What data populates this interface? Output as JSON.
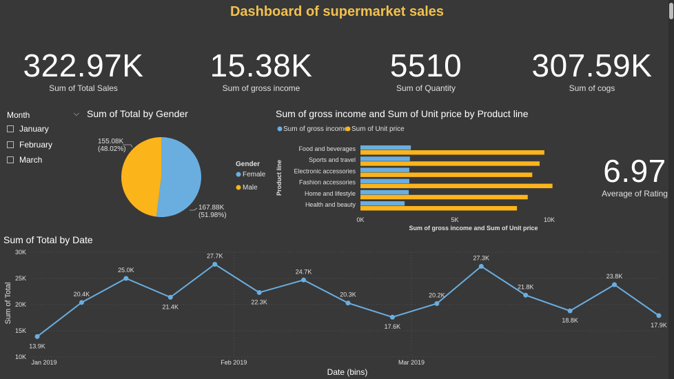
{
  "dashboard_title": "Dashboard of supermarket sales",
  "kpis": {
    "total_sales": {
      "value": "322.97K",
      "label": "Sum of Total Sales"
    },
    "gross_income": {
      "value": "15.38K",
      "label": "Sum of gross income"
    },
    "quantity": {
      "value": "5510",
      "label": "Sum of Quantity"
    },
    "cogs": {
      "value": "307.59K",
      "label": "Sum of cogs"
    },
    "rating": {
      "value": "6.97",
      "label": "Average of Rating"
    }
  },
  "slicer": {
    "title": "Month",
    "items": [
      "January",
      "February",
      "March"
    ]
  },
  "colors": {
    "background": "#383838",
    "title": "#f2c14e",
    "blue": "#6aaee0",
    "yellow": "#fbb41a"
  },
  "chart_data": [
    {
      "type": "pie",
      "title": "Sum of Total by Gender",
      "legend_title": "Gender",
      "slices": [
        {
          "name": "Female",
          "value": 167.88,
          "label": "167.88K",
          "pct": "(51.98%)"
        },
        {
          "name": "Male",
          "value": 155.08,
          "label": "155.08K",
          "pct": "(48.02%)"
        }
      ]
    },
    {
      "type": "bar",
      "orientation": "horizontal",
      "title": "Sum of gross income and Sum of Unit price by Product line",
      "categories": [
        "Food and beverages",
        "Sports and travel",
        "Electronic accessories",
        "Fashion accessories",
        "Home and lifestyle",
        "Health and beauty"
      ],
      "series": [
        {
          "name": "Sum of gross income",
          "values": [
            2670,
            2620,
            2590,
            2590,
            2560,
            2340
          ]
        },
        {
          "name": "Sum of Unit price",
          "values": [
            9740,
            9490,
            9100,
            10170,
            8860,
            8290
          ]
        }
      ],
      "xlabel": "Sum of gross income and Sum of Unit price",
      "ylabel": "Product line",
      "xlim": [
        0,
        10000
      ],
      "xticks": [
        "0K",
        "5K",
        "10K"
      ],
      "legend_position": "top-left"
    },
    {
      "type": "line",
      "title": "Sum of Total by Date",
      "xlabel": "Date (bins)",
      "ylabel": "Sum of Total",
      "x": [
        "2019-01-01",
        "2019-01-08",
        "2019-01-15",
        "2019-01-22",
        "2019-01-29",
        "2019-02-05",
        "2019-02-12",
        "2019-02-19",
        "2019-02-26",
        "2019-03-05",
        "2019-03-12",
        "2019-03-19",
        "2019-03-26",
        "2019-03-30"
      ],
      "values": [
        13.9,
        20.4,
        25.0,
        21.4,
        27.7,
        22.3,
        24.7,
        20.3,
        17.6,
        20.2,
        27.3,
        21.8,
        18.8,
        23.8,
        17.9
      ],
      "points": [
        {
          "date": "2019-01-01",
          "value": 13.9,
          "label": "13.9K"
        },
        {
          "date": "2019-01-08",
          "value": 20.4,
          "label": "20.4K"
        },
        {
          "date": "2019-01-15",
          "value": 25.0,
          "label": "25.0K"
        },
        {
          "date": "2019-01-22",
          "value": 21.4,
          "label": "21.4K"
        },
        {
          "date": "2019-01-29",
          "value": 27.7,
          "label": "27.7K"
        },
        {
          "date": "2019-02-05",
          "value": 22.3,
          "label": "22.3K"
        },
        {
          "date": "2019-02-12",
          "value": 24.7,
          "label": "24.7K"
        },
        {
          "date": "2019-02-19",
          "value": 20.3,
          "label": "20.3K"
        },
        {
          "date": "2019-02-26",
          "value": 17.6,
          "label": "17.6K"
        },
        {
          "date": "2019-03-05",
          "value": 20.2,
          "label": "20.2K"
        },
        {
          "date": "2019-03-12",
          "value": 27.3,
          "label": "27.3K"
        },
        {
          "date": "2019-03-19",
          "value": 21.8,
          "label": "21.8K"
        },
        {
          "date": "2019-03-26",
          "value": 18.8,
          "label": "18.8K"
        },
        {
          "date": "2019-04-02",
          "value": 23.8,
          "label": "23.8K"
        },
        {
          "date": "2019-04-09",
          "value": 17.9,
          "label": "17.9K"
        }
      ],
      "ylim": [
        10,
        30
      ],
      "yticks": [
        "10K",
        "15K",
        "20K",
        "25K",
        "30K"
      ],
      "xticks": [
        "Jan 2019",
        "Feb 2019",
        "Mar 2019"
      ],
      "grid": true
    }
  ]
}
